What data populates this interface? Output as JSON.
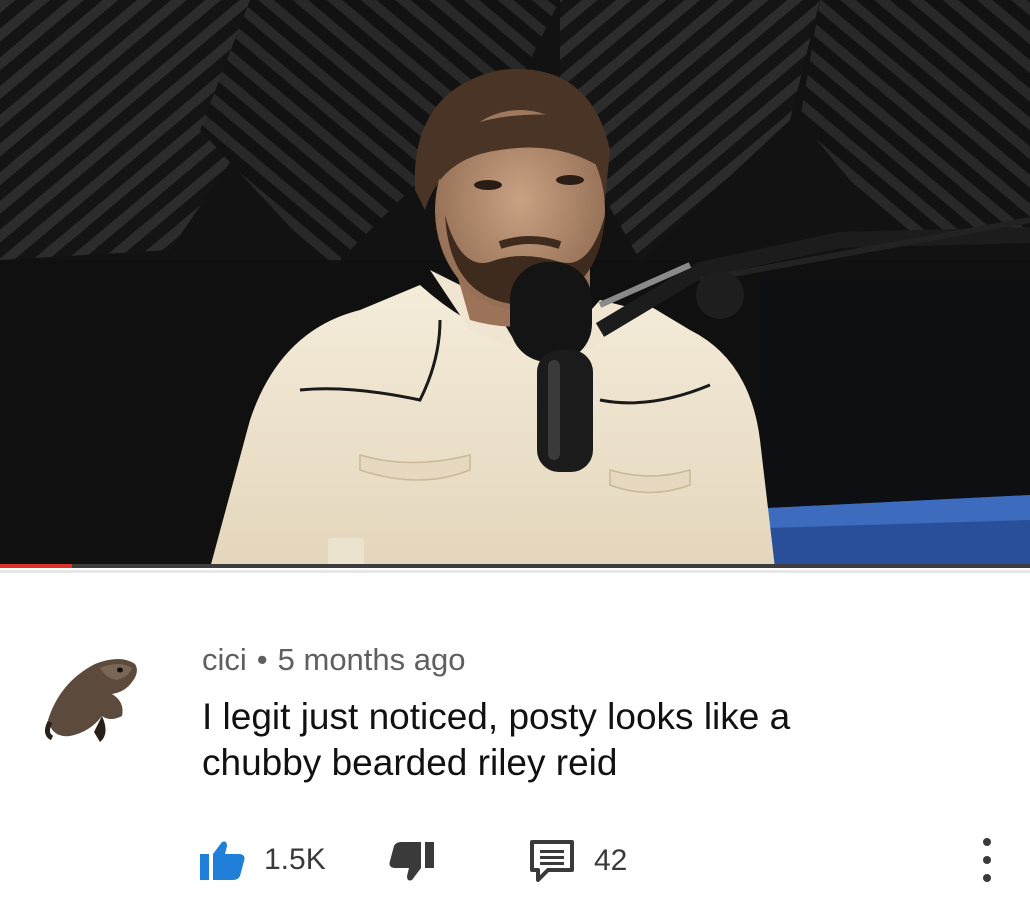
{
  "video": {
    "progress_fraction": 0.07
  },
  "comment": {
    "author": "cici",
    "separator": "•",
    "time": "5 months ago",
    "text_lines": [
      "I legit just noticed, posty looks like a",
      "chubby bearded riley reid"
    ],
    "likes": "1.5K",
    "replies": "42"
  },
  "colors": {
    "like_accent": "#1f7fd9",
    "progress": "#e0302a"
  }
}
